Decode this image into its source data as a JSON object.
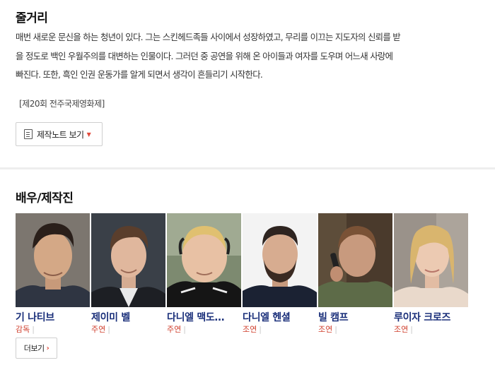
{
  "synopsis": {
    "title": "줄거리",
    "lines": [
      "매번 새로운 문신을 하는 청년이 있다. 그는 스킨헤드족들 사이에서 성장하였고, 무리를 이끄는 지도자의 신뢰를 받",
      "을 정도로 백인 우월주의를 대변하는 인물이다. 그러던 중 공연을 위해 온 아이들과 여자를 도우며 어느새 사랑에",
      "빠진다. 또한, 흑인 인권 운동가를 알게 되면서 생각이 흔들리기 시작한다."
    ],
    "festival": "[제20회 전주국제영화제]",
    "note_button": "제작노트 보기"
  },
  "cast_section": {
    "title": "배우/제작진",
    "members": [
      {
        "name": "기 나티브",
        "role": "감독"
      },
      {
        "name": "제이미 벨",
        "role": "주연"
      },
      {
        "name": "다니엘 맥도…",
        "role": "주연"
      },
      {
        "name": "다니엘 헨셜",
        "role": "조연"
      },
      {
        "name": "빌 캠프",
        "role": "조연"
      },
      {
        "name": "루이자 크로즈",
        "role": "조연"
      }
    ],
    "more_button": "더보기"
  },
  "colors": {
    "name_text": "#1a2f7a",
    "role_text": "#d0402f",
    "accent": "#e24a3b"
  }
}
